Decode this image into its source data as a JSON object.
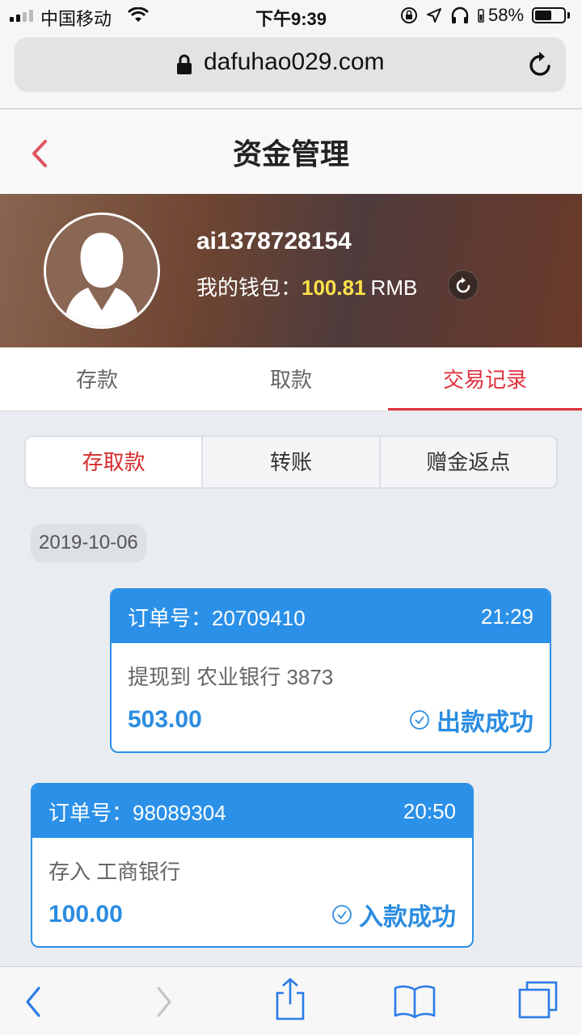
{
  "status_bar": {
    "carrier": "中国移动",
    "time": "下午9:39",
    "battery_percent": "58%",
    "battery_level": 0.58,
    "icons": [
      "signal-icon",
      "wifi-icon",
      "rotation-lock-icon",
      "location-icon",
      "headphones-icon",
      "battery-icon"
    ]
  },
  "browser": {
    "url": "dafuhao029.com",
    "icons": [
      "lock-icon",
      "reload-icon",
      "back-icon",
      "forward-icon",
      "share-icon",
      "bookmarks-icon",
      "tabs-icon"
    ]
  },
  "header": {
    "title": "资金管理",
    "back_icon": "chevron-left-icon"
  },
  "profile": {
    "username": "ai1378728154",
    "wallet_label": "我的钱包：",
    "wallet_amount": "100.81",
    "wallet_currency": "RMB"
  },
  "tabs": [
    {
      "label": "存款",
      "active": false
    },
    {
      "label": "取款",
      "active": false
    },
    {
      "label": "交易记录",
      "active": true
    }
  ],
  "segments": [
    {
      "label": "存取款",
      "active": true
    },
    {
      "label": "转账",
      "active": false
    },
    {
      "label": "赠金返点",
      "active": false
    }
  ],
  "date": "2019-10-06",
  "records": [
    {
      "order_label": "订单号：",
      "order_no": "20709410",
      "time": "21:29",
      "description": "提现到 农业银行 3873",
      "amount": "503.00",
      "status": "出款成功"
    },
    {
      "order_label": "订单号：",
      "order_no": "98089304",
      "time": "20:50",
      "description": "存入 工商银行",
      "amount": "100.00",
      "status": "入款成功"
    }
  ],
  "colors": {
    "accent_red": "#e0303e",
    "accent_blue": "#2b90e8",
    "wallet_amount": "#ffe14a"
  }
}
